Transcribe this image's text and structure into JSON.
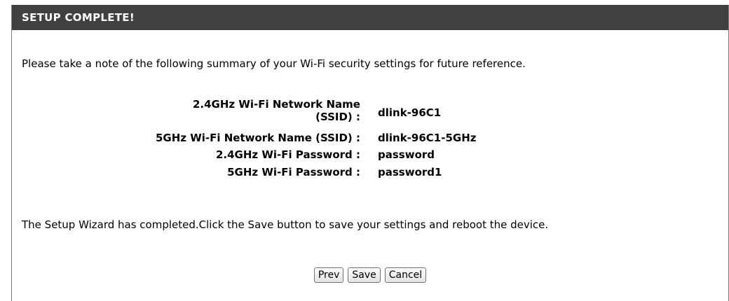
{
  "header": {
    "title": "SETUP COMPLETE!"
  },
  "intro_text": "Please take a note of the following summary of your Wi-Fi security settings for future reference.",
  "summary": {
    "ssid_24_label_line1": "2.4GHz Wi-Fi Network Name",
    "ssid_24_label_line2": "(SSID) :",
    "ssid_24_value": "dlink-96C1",
    "ssid_5_label": "5GHz Wi-Fi Network Name (SSID) :",
    "ssid_5_value": "dlink-96C1-5GHz",
    "pw_24_label": "2.4GHz Wi-Fi Password :",
    "pw_24_value": "password",
    "pw_5_label": "5GHz Wi-Fi Password :",
    "pw_5_value": "password1"
  },
  "outro_text": "The Setup Wizard has completed.Click the Save button to save your settings and reboot the device.",
  "buttons": {
    "prev": "Prev",
    "save": "Save",
    "cancel": "Cancel"
  },
  "colors": {
    "header_bg": "#404040",
    "header_text": "#ffffff"
  }
}
